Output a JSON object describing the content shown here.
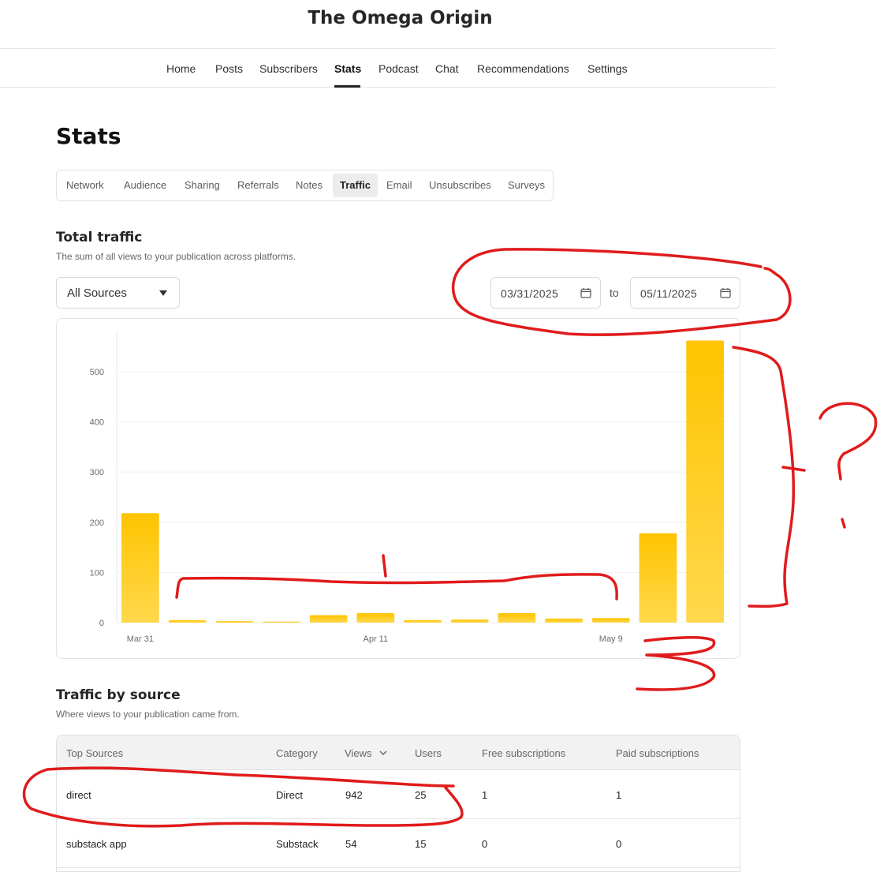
{
  "publication": {
    "title": "The Omega Origin"
  },
  "topnav": {
    "items": [
      {
        "label": "Home"
      },
      {
        "label": "Posts"
      },
      {
        "label": "Subscribers"
      },
      {
        "label": "Stats",
        "active": true
      },
      {
        "label": "Podcast"
      },
      {
        "label": "Chat"
      },
      {
        "label": "Recommendations"
      },
      {
        "label": "Settings"
      }
    ]
  },
  "page": {
    "title": "Stats"
  },
  "subtabs": {
    "items": [
      {
        "label": "Network"
      },
      {
        "label": "Audience"
      },
      {
        "label": "Sharing"
      },
      {
        "label": "Referrals"
      },
      {
        "label": "Notes"
      },
      {
        "label": "Traffic",
        "active": true
      },
      {
        "label": "Email"
      },
      {
        "label": "Unsubscribes"
      },
      {
        "label": "Surveys"
      }
    ]
  },
  "total_traffic": {
    "title": "Total traffic",
    "subtitle": "The sum of all views to your publication across platforms.",
    "source_select": {
      "value": "All Sources"
    },
    "date_from": "03/31/2025",
    "date_to": "05/11/2025",
    "date_separator": "to"
  },
  "chart_data": {
    "type": "bar",
    "categories": [
      "Mar 31",
      "",
      "",
      "",
      "",
      "Apr 11",
      "",
      "",
      "",
      "",
      "May 9",
      "",
      ""
    ],
    "values": [
      218,
      5,
      3,
      2,
      15,
      19,
      5,
      6,
      19,
      8,
      9,
      178,
      562
    ],
    "ylim": [
      0,
      580
    ],
    "yticks": [
      0,
      100,
      200,
      300,
      400,
      500
    ],
    "xtick_labels": [
      "Mar 31",
      "Apr 11",
      "May 9"
    ],
    "grid": true,
    "colors": {
      "bar_top": "#ffc400",
      "bar_bottom": "#ffd84d"
    }
  },
  "traffic_by_source": {
    "title": "Traffic by source",
    "subtitle": "Where views to your publication came from.",
    "columns": [
      "Top Sources",
      "Category",
      "Views",
      "Users",
      "Free subscriptions",
      "Paid subscriptions"
    ],
    "rows": [
      {
        "source": "direct",
        "category": "Direct",
        "views": "942",
        "users": "25",
        "free": "1",
        "paid": "1"
      },
      {
        "source": "substack app",
        "category": "Substack",
        "views": "54",
        "users": "15",
        "free": "0",
        "paid": "0"
      }
    ]
  },
  "colors": {
    "annotation": "#e01b1b",
    "accent": "#ffc400"
  }
}
